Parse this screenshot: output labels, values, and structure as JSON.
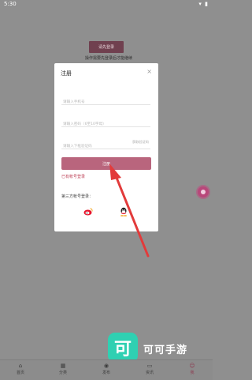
{
  "status_bar": {
    "time": "5:30",
    "icons": "▾ ▮"
  },
  "background": {
    "login_button": "请先登录",
    "login_hint": "操作需要先登录后才能继续"
  },
  "modal": {
    "title": "注册",
    "close": "×",
    "phone_placeholder": "请输入手机号",
    "password_placeholder": "请输入密码（6至10字母）",
    "code_placeholder": "请输入下框验证码",
    "get_code": "获取验证码",
    "register_button": "注册",
    "have_account": "已有帐号登录",
    "third_party_label": "第三方帐号登录："
  },
  "watermark": {
    "logo_char": "可",
    "text": "可可手游"
  },
  "tabs": [
    {
      "label": "首页",
      "icon": "⌂"
    },
    {
      "label": "分类",
      "icon": "▦"
    },
    {
      "label": "发布",
      "icon": "◉"
    },
    {
      "label": "资讯",
      "icon": "▭"
    },
    {
      "label": "我",
      "icon": "☺"
    }
  ],
  "colors": {
    "accent": "#b9657d",
    "link": "#c0475c",
    "arrow": "#e23b3b"
  }
}
